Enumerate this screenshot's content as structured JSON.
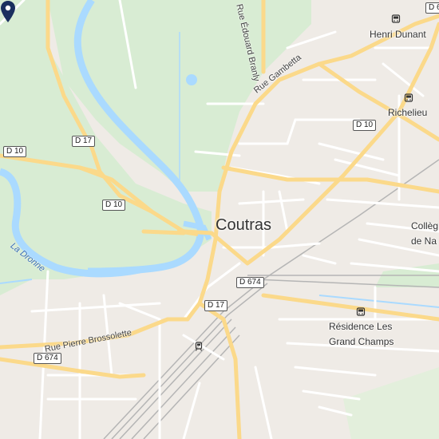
{
  "map": {
    "place_name": "Coutras",
    "colors": {
      "land": "#efebe6",
      "park": "#d8ecd3",
      "water": "#aadaff",
      "road_major": "#fbd98a",
      "road_minor": "#ffffff",
      "pin": "#1a2f5e",
      "rail": "#b5b5b5"
    },
    "road_shields": [
      {
        "label": "D 10",
        "id": "d10-west"
      },
      {
        "label": "D 17",
        "id": "d17-north"
      },
      {
        "label": "D 10",
        "id": "d10-center"
      },
      {
        "label": "D 10",
        "id": "d10-east"
      },
      {
        "label": "D 674",
        "id": "d674-center"
      },
      {
        "label": "D 17",
        "id": "d17-south"
      },
      {
        "label": "D 674",
        "id": "d674-west"
      },
      {
        "label": "D 6",
        "id": "d6-top"
      }
    ],
    "streets": [
      {
        "label": "Rue Gambetta"
      },
      {
        "label": "Rue Édouard Branly"
      },
      {
        "label": "Rue Pierre Brossolette"
      }
    ],
    "river": {
      "label": "La Dronne"
    },
    "stops": [
      {
        "label": "Henri Dunant"
      },
      {
        "label": "Richelieu"
      },
      {
        "label_line1": "Résidence Les",
        "label_line2": "Grand Champs"
      }
    ],
    "poi": {
      "line1": "Collèg",
      "line2": "de Na"
    },
    "icons": {
      "bus": "bus-icon",
      "train": "train-icon",
      "pin": "location-pin-icon"
    }
  }
}
